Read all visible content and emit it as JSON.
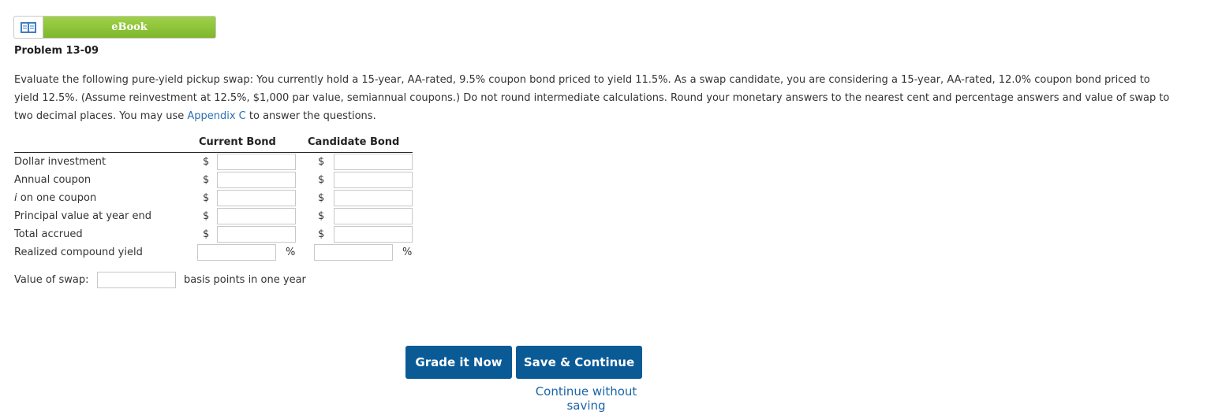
{
  "ebook": {
    "label": "eBook",
    "icon": "book-icon"
  },
  "problem": {
    "title": "Problem 13-09"
  },
  "question": {
    "line1": "Evaluate the following pure-yield pickup swap: You currently hold a 15-year, AA-rated, 9.5% coupon bond priced to yield 11.5%. As a swap candidate, you are considering a 15-year, AA-rated, 12.0% coupon bond priced to",
    "line2": "yield 12.5%. (Assume reinvestment at 12.5%, $1,000 par value, semiannual coupons.) Do not round intermediate calculations. Round your monetary answers to the nearest cent and percentage answers and value of swap to",
    "line3_pre": "two decimal places. You may use ",
    "link": "Appendix C",
    "line3_post": " to answer the questions."
  },
  "table": {
    "col_current": "Current Bond",
    "col_candidate": "Candidate Bond",
    "currency": "$",
    "percent": "%",
    "rows": [
      {
        "label": "Dollar investment",
        "current": "",
        "candidate": ""
      },
      {
        "label": "Annual coupon",
        "current": "",
        "candidate": ""
      },
      {
        "label_italic": "i",
        "label_rest": " on one coupon",
        "current": "",
        "candidate": ""
      },
      {
        "label": "Principal value at year end",
        "current": "",
        "candidate": ""
      },
      {
        "label": "Total accrued",
        "current": "",
        "candidate": ""
      },
      {
        "label": "Realized compound yield",
        "current": "",
        "candidate": ""
      }
    ]
  },
  "swap": {
    "label": "Value of swap:",
    "value": "",
    "suffix": "basis points in one year"
  },
  "buttons": {
    "grade": "Grade it Now",
    "save": "Save & Continue",
    "continue": "Continue without saving"
  },
  "colors": {
    "ebook_green": "#8dc63f",
    "button_blue": "#0a5a96",
    "link_blue": "#2a6fb0"
  }
}
